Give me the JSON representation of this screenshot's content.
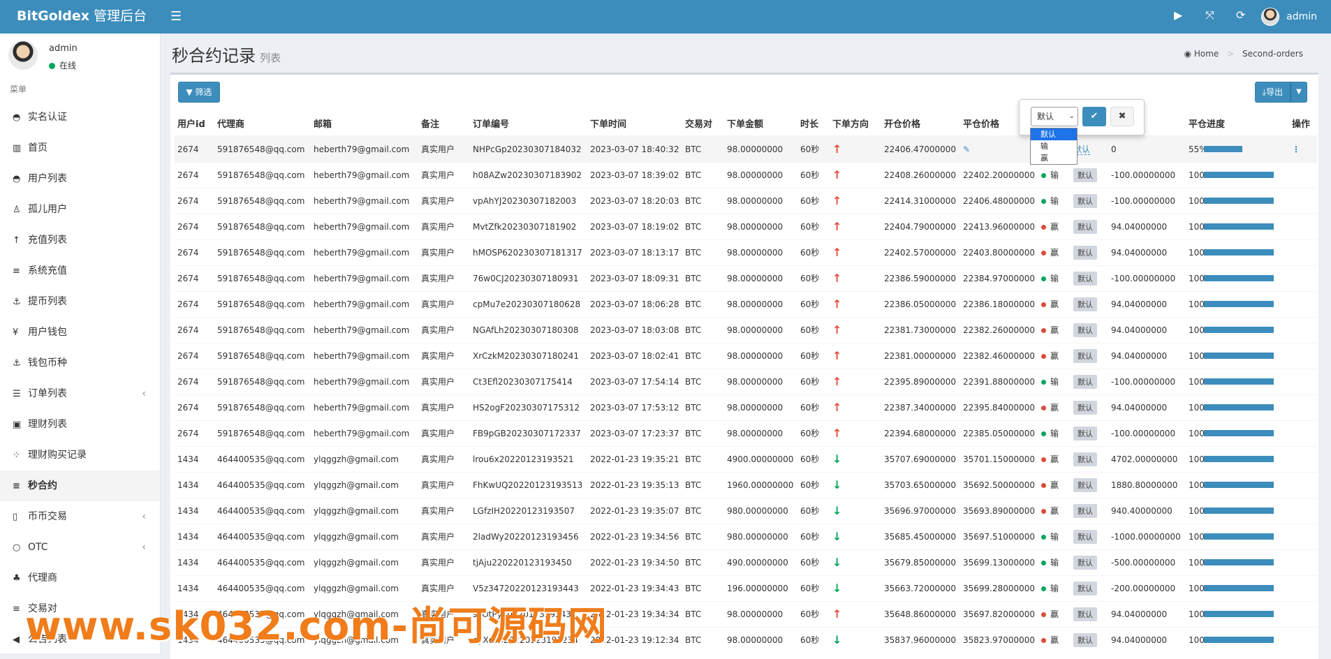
{
  "app": {
    "brand": "BitGoldex",
    "brand_suffix": " 管理后台"
  },
  "topbar": {
    "user": "admin",
    "icons": [
      "play-icon",
      "fullscreen-icon",
      "refresh-icon"
    ]
  },
  "sidebar": {
    "user_name": "admin",
    "user_status": "在线",
    "menu_header": "菜单",
    "items": [
      {
        "label": "实名认证",
        "icon": "◓",
        "name": "sidebar-item-real-name"
      },
      {
        "label": "首页",
        "icon": "▥",
        "name": "sidebar-item-home"
      },
      {
        "label": "用户列表",
        "icon": "◓",
        "name": "sidebar-item-users"
      },
      {
        "label": "孤儿用户",
        "icon": "♙",
        "name": "sidebar-item-orphan-users"
      },
      {
        "label": "充值列表",
        "icon": "↑",
        "name": "sidebar-item-recharge-list"
      },
      {
        "label": "系统充值",
        "icon": "≡",
        "name": "sidebar-item-system-recharge"
      },
      {
        "label": "提币列表",
        "icon": "⚓",
        "name": "sidebar-item-withdraw-list"
      },
      {
        "label": "用户钱包",
        "icon": "¥",
        "name": "sidebar-item-user-wallet"
      },
      {
        "label": "钱包币种",
        "icon": "⚓",
        "name": "sidebar-item-wallet-currency"
      },
      {
        "label": "订单列表",
        "icon": "☰",
        "name": "sidebar-item-orders",
        "arrow": "‹"
      },
      {
        "label": "理财列表",
        "icon": "▣",
        "name": "sidebar-item-finance-list"
      },
      {
        "label": "理财购买记录",
        "icon": "⁘",
        "name": "sidebar-item-finance-records"
      },
      {
        "label": "秒合约",
        "icon": "≡",
        "name": "sidebar-item-second-contract",
        "active": true
      },
      {
        "label": "币币交易",
        "icon": "▯",
        "name": "sidebar-item-coin-trade",
        "arrow": "‹"
      },
      {
        "label": "OTC",
        "icon": "○",
        "name": "sidebar-item-otc",
        "arrow": "‹"
      },
      {
        "label": "代理商",
        "icon": "♣",
        "name": "sidebar-item-agents"
      },
      {
        "label": "交易对",
        "icon": "≡",
        "name": "sidebar-item-trading-pairs"
      },
      {
        "label": "公告列表",
        "icon": "◀",
        "name": "sidebar-item-announcements"
      }
    ]
  },
  "page": {
    "title": "秒合约记录",
    "subtitle": "列表",
    "breadcrumb": [
      "Home",
      "Second-orders"
    ]
  },
  "toolbar": {
    "filter_label": "筛选",
    "export_label": "导出"
  },
  "table": {
    "columns": [
      "用户id",
      "代理商",
      "邮箱",
      "备注",
      "订单编号",
      "下单时间",
      "交易对",
      "下单金额",
      "时长",
      "下单方向",
      "开仓价格",
      "平仓价格",
      "",
      "",
      "盈亏",
      "平仓进度",
      "操作"
    ],
    "visible_headers": [
      "用户id",
      "代理商",
      "邮箱",
      "备注",
      "订单编号",
      "下单时间",
      "交易对",
      "下单金额",
      "时长",
      "下单方向",
      "开仓价格",
      "平仓价格",
      "",
      "",
      "亏",
      "平仓进度",
      "操作"
    ],
    "rows": [
      {
        "uid": "2674",
        "agent": "591876548@qq.com",
        "email": "heberth79@gmail.com",
        "note": "真实用户",
        "order": "NHPcGp20230307184032",
        "time": "2023-03-07 18:40:32",
        "pair": "BTC",
        "amount": "98.00000000",
        "dur": "60秒",
        "dir": "up",
        "open": "22406.47000000",
        "close": "",
        "result": "",
        "label": "默认",
        "pnl": "0",
        "pct": "55%",
        "progress": 0.55
      },
      {
        "uid": "2674",
        "agent": "591876548@qq.com",
        "email": "heberth79@gmail.com",
        "note": "真实用户",
        "order": "h08AZw20230307183902",
        "time": "2023-03-07 18:39:02",
        "pair": "BTC",
        "amount": "98.00000000",
        "dur": "60秒",
        "dir": "up",
        "open": "22408.26000000",
        "close": "22402.20000000",
        "result": "输",
        "label": "默认",
        "pnl": "-100.00000000",
        "pct": "100%",
        "progress": 1
      },
      {
        "uid": "2674",
        "agent": "591876548@qq.com",
        "email": "heberth79@gmail.com",
        "note": "真实用户",
        "order": "vpAhYJ20230307182003",
        "time": "2023-03-07 18:20:03",
        "pair": "BTC",
        "amount": "98.00000000",
        "dur": "60秒",
        "dir": "up",
        "open": "22414.31000000",
        "close": "22406.48000000",
        "result": "输",
        "label": "默认",
        "pnl": "-100.00000000",
        "pct": "100%",
        "progress": 1
      },
      {
        "uid": "2674",
        "agent": "591876548@qq.com",
        "email": "heberth79@gmail.com",
        "note": "真实用户",
        "order": "MvtZfk20230307181902",
        "time": "2023-03-07 18:19:02",
        "pair": "BTC",
        "amount": "98.00000000",
        "dur": "60秒",
        "dir": "up",
        "open": "22404.79000000",
        "close": "22413.96000000",
        "result": "赢",
        "label": "默认",
        "pnl": "94.04000000",
        "pct": "100%",
        "progress": 1
      },
      {
        "uid": "2674",
        "agent": "591876548@qq.com",
        "email": "heberth79@gmail.com",
        "note": "真实用户",
        "order": "hMOSP620230307181317",
        "time": "2023-03-07 18:13:17",
        "pair": "BTC",
        "amount": "98.00000000",
        "dur": "60秒",
        "dir": "up",
        "open": "22402.57000000",
        "close": "22403.80000000",
        "result": "赢",
        "label": "默认",
        "pnl": "94.04000000",
        "pct": "100%",
        "progress": 1
      },
      {
        "uid": "2674",
        "agent": "591876548@qq.com",
        "email": "heberth79@gmail.com",
        "note": "真实用户",
        "order": "76w0CJ20230307180931",
        "time": "2023-03-07 18:09:31",
        "pair": "BTC",
        "amount": "98.00000000",
        "dur": "60秒",
        "dir": "up",
        "open": "22386.59000000",
        "close": "22384.97000000",
        "result": "输",
        "label": "默认",
        "pnl": "-100.00000000",
        "pct": "100%",
        "progress": 1
      },
      {
        "uid": "2674",
        "agent": "591876548@qq.com",
        "email": "heberth79@gmail.com",
        "note": "真实用户",
        "order": "cpMu7e20230307180628",
        "time": "2023-03-07 18:06:28",
        "pair": "BTC",
        "amount": "98.00000000",
        "dur": "60秒",
        "dir": "up",
        "open": "22386.05000000",
        "close": "22386.18000000",
        "result": "赢",
        "label": "默认",
        "pnl": "94.04000000",
        "pct": "100%",
        "progress": 1
      },
      {
        "uid": "2674",
        "agent": "591876548@qq.com",
        "email": "heberth79@gmail.com",
        "note": "真实用户",
        "order": "NGAfLh20230307180308",
        "time": "2023-03-07 18:03:08",
        "pair": "BTC",
        "amount": "98.00000000",
        "dur": "60秒",
        "dir": "up",
        "open": "22381.73000000",
        "close": "22382.26000000",
        "result": "赢",
        "label": "默认",
        "pnl": "94.04000000",
        "pct": "100%",
        "progress": 1
      },
      {
        "uid": "2674",
        "agent": "591876548@qq.com",
        "email": "heberth79@gmail.com",
        "note": "真实用户",
        "order": "XrCzkM20230307180241",
        "time": "2023-03-07 18:02:41",
        "pair": "BTC",
        "amount": "98.00000000",
        "dur": "60秒",
        "dir": "up",
        "open": "22381.00000000",
        "close": "22382.46000000",
        "result": "赢",
        "label": "默认",
        "pnl": "94.04000000",
        "pct": "100%",
        "progress": 1
      },
      {
        "uid": "2674",
        "agent": "591876548@qq.com",
        "email": "heberth79@gmail.com",
        "note": "真实用户",
        "order": "Ct3Efl20230307175414",
        "time": "2023-03-07 17:54:14",
        "pair": "BTC",
        "amount": "98.00000000",
        "dur": "60秒",
        "dir": "up",
        "open": "22395.89000000",
        "close": "22391.88000000",
        "result": "输",
        "label": "默认",
        "pnl": "-100.00000000",
        "pct": "100%",
        "progress": 1
      },
      {
        "uid": "2674",
        "agent": "591876548@qq.com",
        "email": "heberth79@gmail.com",
        "note": "真实用户",
        "order": "HS2ogF20230307175312",
        "time": "2023-03-07 17:53:12",
        "pair": "BTC",
        "amount": "98.00000000",
        "dur": "60秒",
        "dir": "up",
        "open": "22387.34000000",
        "close": "22395.84000000",
        "result": "赢",
        "label": "默认",
        "pnl": "94.04000000",
        "pct": "100%",
        "progress": 1
      },
      {
        "uid": "2674",
        "agent": "591876548@qq.com",
        "email": "heberth79@gmail.com",
        "note": "真实用户",
        "order": "FB9pGB20230307172337",
        "time": "2023-03-07 17:23:37",
        "pair": "BTC",
        "amount": "98.00000000",
        "dur": "60秒",
        "dir": "up",
        "open": "22394.68000000",
        "close": "22385.05000000",
        "result": "输",
        "label": "默认",
        "pnl": "-100.00000000",
        "pct": "100%",
        "progress": 1
      },
      {
        "uid": "1434",
        "agent": "464400535@qq.com",
        "email": "ylqggzh@gmail.com",
        "note": "真实用户",
        "order": "lrou6x20220123193521",
        "time": "2022-01-23 19:35:21",
        "pair": "BTC",
        "amount": "4900.00000000",
        "dur": "60秒",
        "dir": "down",
        "open": "35707.69000000",
        "close": "35701.15000000",
        "result": "赢",
        "label": "默认",
        "pnl": "4702.00000000",
        "pct": "100%",
        "progress": 1
      },
      {
        "uid": "1434",
        "agent": "464400535@qq.com",
        "email": "ylqggzh@gmail.com",
        "note": "真实用户",
        "order": "FhKwUQ20220123193513",
        "time": "2022-01-23 19:35:13",
        "pair": "BTC",
        "amount": "1960.00000000",
        "dur": "60秒",
        "dir": "down",
        "open": "35703.65000000",
        "close": "35692.50000000",
        "result": "赢",
        "label": "默认",
        "pnl": "1880.80000000",
        "pct": "100%",
        "progress": 1
      },
      {
        "uid": "1434",
        "agent": "464400535@qq.com",
        "email": "ylqggzh@gmail.com",
        "note": "真实用户",
        "order": "LGfzIH20220123193507",
        "time": "2022-01-23 19:35:07",
        "pair": "BTC",
        "amount": "980.00000000",
        "dur": "60秒",
        "dir": "down",
        "open": "35696.97000000",
        "close": "35693.89000000",
        "result": "赢",
        "label": "默认",
        "pnl": "940.40000000",
        "pct": "100%",
        "progress": 1
      },
      {
        "uid": "1434",
        "agent": "464400535@qq.com",
        "email": "ylqggzh@gmail.com",
        "note": "真实用户",
        "order": "2ladWy20220123193456",
        "time": "2022-01-23 19:34:56",
        "pair": "BTC",
        "amount": "980.00000000",
        "dur": "60秒",
        "dir": "down",
        "open": "35685.45000000",
        "close": "35697.51000000",
        "result": "输",
        "label": "默认",
        "pnl": "-1000.00000000",
        "pct": "100%",
        "progress": 1
      },
      {
        "uid": "1434",
        "agent": "464400535@qq.com",
        "email": "ylqggzh@gmail.com",
        "note": "真实用户",
        "order": "tjAju220220123193450",
        "time": "2022-01-23 19:34:50",
        "pair": "BTC",
        "amount": "490.00000000",
        "dur": "60秒",
        "dir": "down",
        "open": "35679.85000000",
        "close": "35699.13000000",
        "result": "输",
        "label": "默认",
        "pnl": "-500.00000000",
        "pct": "100%",
        "progress": 1
      },
      {
        "uid": "1434",
        "agent": "464400535@qq.com",
        "email": "ylqggzh@gmail.com",
        "note": "真实用户",
        "order": "V5z34720220123193443",
        "time": "2022-01-23 19:34:43",
        "pair": "BTC",
        "amount": "196.00000000",
        "dur": "60秒",
        "dir": "down",
        "open": "35663.72000000",
        "close": "35699.28000000",
        "result": "输",
        "label": "默认",
        "pnl": "-200.00000000",
        "pct": "100%",
        "progress": 1
      },
      {
        "uid": "1434",
        "agent": "464400535@qq.com",
        "email": "ylqggzh@gmail.com",
        "note": "真实用户",
        "order": "skOtPy20220123193434",
        "time": "2022-01-23 19:34:34",
        "pair": "BTC",
        "amount": "98.00000000",
        "dur": "60秒",
        "dir": "up",
        "open": "35648.86000000",
        "close": "35697.82000000",
        "result": "赢",
        "label": "默认",
        "pnl": "94.04000000",
        "pct": "100%",
        "progress": 1
      },
      {
        "uid": "1434",
        "agent": "464400535@qq.com",
        "email": "ylqggzh@gmail.com",
        "note": "真实用户",
        "order": "eyXcv820220123191234",
        "time": "2022-01-23 19:12:34",
        "pair": "BTC",
        "amount": "98.00000000",
        "dur": "60秒",
        "dir": "down",
        "open": "35837.96000000",
        "close": "35823.97000000",
        "result": "赢",
        "label": "默认",
        "pnl": "94.04000000",
        "pct": "100%",
        "progress": 1
      }
    ]
  },
  "popover": {
    "select_value": "默认",
    "options": [
      "默认",
      "输",
      "赢"
    ],
    "selected_index": 0
  },
  "watermark": "www.sk032.com-尚可源码网",
  "colors": {
    "primary": "#3c8dbc",
    "win": "#dd4b39",
    "lose": "#00a65a"
  }
}
